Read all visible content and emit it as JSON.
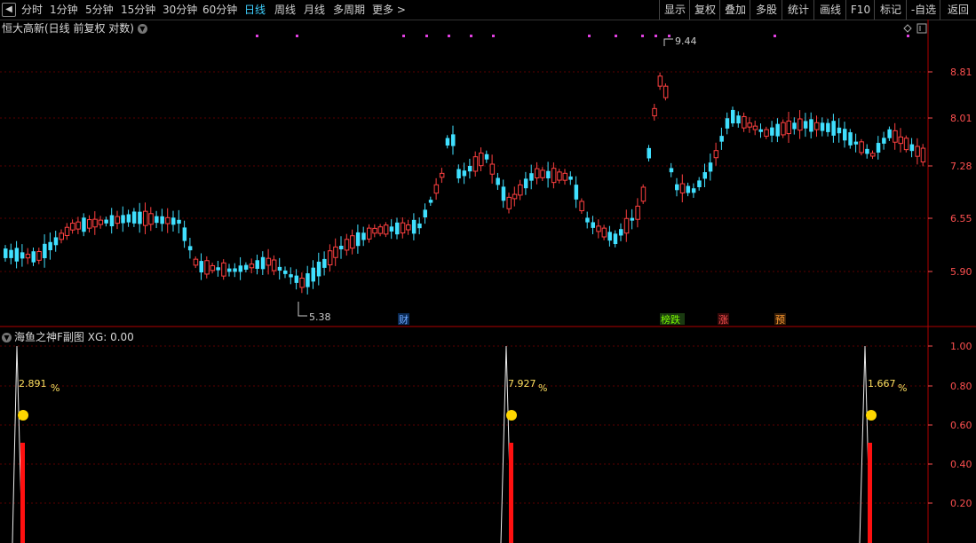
{
  "toolbar": {
    "back_icon": "back-icon",
    "periods": [
      "分时",
      "1分钟",
      "5分钟",
      "15分钟",
      "30分钟",
      "60分钟",
      "日线",
      "周线",
      "月线",
      "多周期",
      "更多 >"
    ],
    "active_period": "日线",
    "right_buttons": [
      "显示",
      "复权",
      "叠加",
      "多股",
      "统计",
      "画线",
      "F10",
      "标记",
      "-自选",
      "返回"
    ]
  },
  "main_chart": {
    "title": "恒大高新(日线 前复权 对数)",
    "y_ticks": [
      "8.81",
      "8.01",
      "7.28",
      "6.55",
      "5.90"
    ],
    "high_label": "9.44",
    "low_label": "5.38",
    "markers": [
      {
        "text": "财",
        "color": "#6fa8ff"
      },
      {
        "text": "榜跌",
        "color": "#7cfc00"
      },
      {
        "text": "涨",
        "color": "#ff5050"
      },
      {
        "text": "预",
        "color": "#ff9a30"
      }
    ]
  },
  "sub_chart": {
    "title": "海鱼之神F副图 XG: 0.00",
    "y_ticks": [
      "1.00",
      "0.80",
      "0.60",
      "0.40",
      "0.20"
    ],
    "signals": [
      {
        "pct": "2.891",
        "unit": "%"
      },
      {
        "pct": "7.927",
        "unit": "%"
      },
      {
        "pct": "1.667",
        "unit": "%"
      }
    ]
  },
  "colors": {
    "up": "#ff4040",
    "down": "#40e0ff",
    "grid": "#5a0000",
    "axis": "#b00000"
  }
}
